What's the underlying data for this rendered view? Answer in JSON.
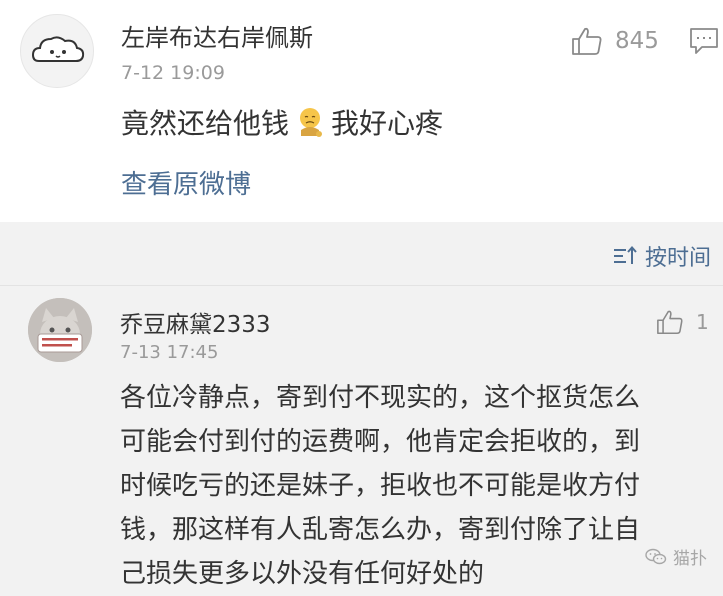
{
  "post": {
    "username": "左岸布达右岸佩斯",
    "time": "7-12 19:09",
    "content_before": "竟然还给他钱",
    "content_emoji": "sad-face-emoji",
    "content_after": "我好心疼",
    "view_original": "查看原微博",
    "like_count": "845",
    "avatar_icon": "cloud-avatar-icon"
  },
  "sort": {
    "label": "按时间",
    "icon": "sort-icon"
  },
  "reply": {
    "username": "乔豆麻黛2333",
    "time": "7-13 17:45",
    "like_count": "1",
    "lines": [
      "各位冷静点，寄到付不现实的，这个抠货怎么",
      "可能会付到付的运费啊，他肯定会拒收的，到",
      "时候吃亏的还是妹子，拒收也不可能是收方付",
      "钱，那这样有人乱寄怎么办，寄到付除了让自",
      "己损失更多以外没有任何好处的"
    ]
  },
  "watermark": {
    "text": "猫扑",
    "icon": "wechat-icon"
  },
  "colors": {
    "link": "#4d6e93",
    "meta_gray": "#9a9a9a",
    "text": "#333333",
    "background": "#f2f2f2",
    "card": "#ffffff"
  }
}
